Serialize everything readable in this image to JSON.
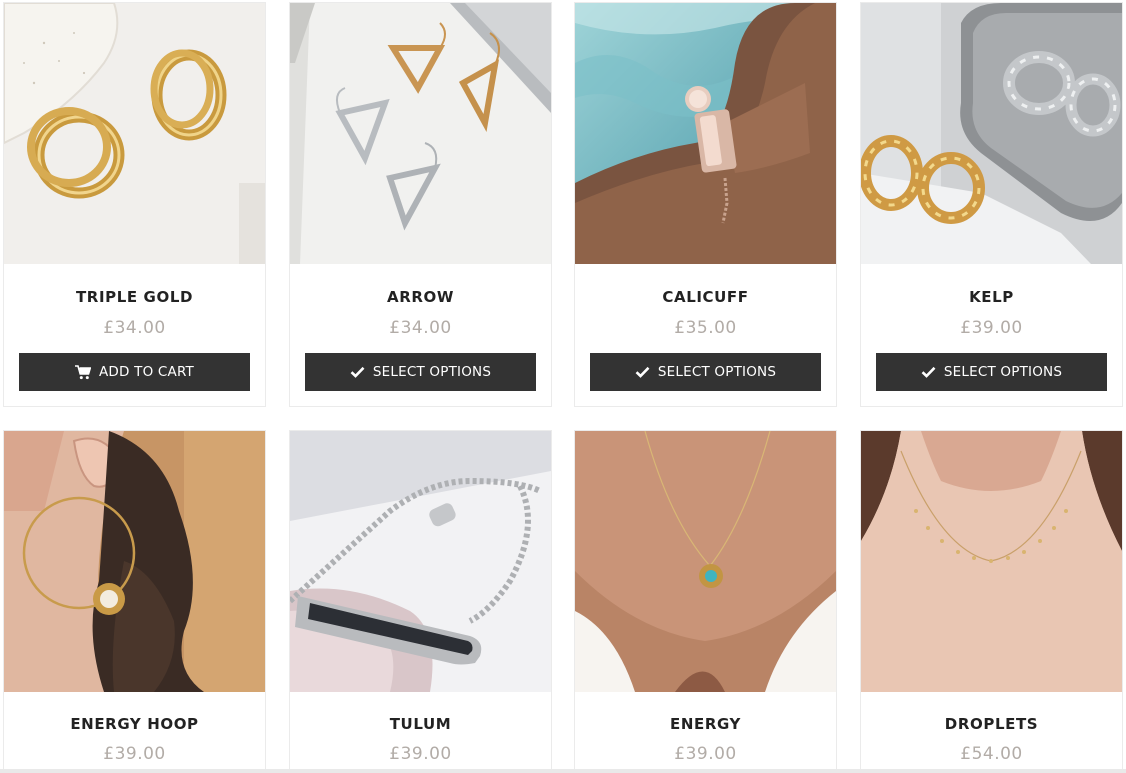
{
  "products": [
    {
      "name": "TRIPLE GOLD",
      "price": "£34.00",
      "button": {
        "label": "ADD TO CART",
        "icon": "cart-icon"
      }
    },
    {
      "name": "ARROW",
      "price": "£34.00",
      "button": {
        "label": "SELECT OPTIONS",
        "icon": "checkmark-icon"
      }
    },
    {
      "name": "CALICUFF",
      "price": "£35.00",
      "button": {
        "label": "SELECT OPTIONS",
        "icon": "checkmark-icon"
      }
    },
    {
      "name": "KELP",
      "price": "£39.00",
      "button": {
        "label": "SELECT OPTIONS",
        "icon": "checkmark-icon"
      }
    },
    {
      "name": "ENERGY HOOP",
      "price": "£39.00"
    },
    {
      "name": "TULUM",
      "price": "£39.00"
    },
    {
      "name": "ENERGY",
      "price": "£39.00"
    },
    {
      "name": "DROPLETS",
      "price": "£54.00"
    }
  ],
  "colors": {
    "button_bg": "#333333",
    "button_text": "#ffffff",
    "title": "#222222",
    "price": "#b2aca7",
    "card_border": "#ebebeb"
  }
}
